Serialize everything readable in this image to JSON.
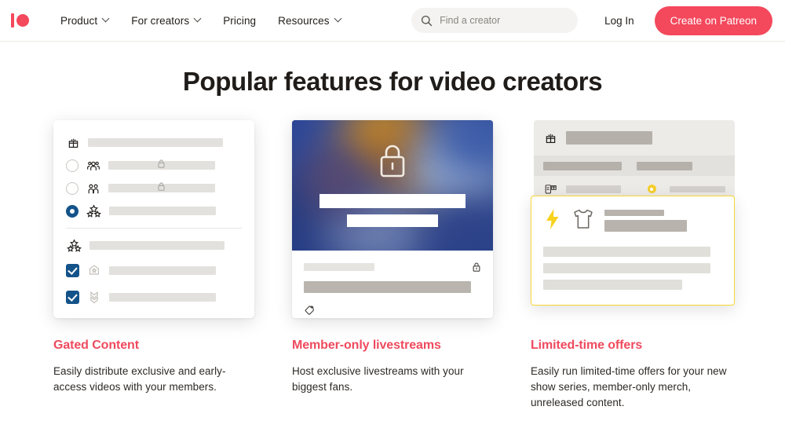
{
  "header": {
    "logo": {
      "name": "patreon-logo",
      "color": "#f4485c"
    },
    "nav": [
      {
        "label": "Product",
        "has_dropdown": true
      },
      {
        "label": "For creators",
        "has_dropdown": true
      },
      {
        "label": "Pricing",
        "has_dropdown": false
      },
      {
        "label": "Resources",
        "has_dropdown": true
      }
    ],
    "search": {
      "placeholder": "Find a creator",
      "value": "",
      "icon": "search-icon"
    },
    "login_label": "Log In",
    "cta_label": "Create on Patreon",
    "cta_color": "#f4485c"
  },
  "page_title": "Popular features for video creators",
  "features": [
    {
      "title": "Gated Content",
      "title_color": "#ef4a5e",
      "description": "Easily distribute exclusive and early-access videos with your members.",
      "mock": {
        "type": "tier-selection-list",
        "rows": [
          {
            "control": "none",
            "icon": "gift-icon",
            "locked": false
          },
          {
            "control": "radio-off",
            "icon": "group-three-icon",
            "locked": true
          },
          {
            "control": "radio-off",
            "icon": "group-two-icon",
            "locked": true
          },
          {
            "control": "radio-on",
            "icon": "stars-icon",
            "locked": false
          },
          {
            "control": "none",
            "icon": "stars-icon",
            "locked": false
          },
          {
            "control": "checkbox-on",
            "icon": "badge-star-icon",
            "locked": false
          },
          {
            "control": "checkbox-on",
            "icon": "bookmark-chevron-icon",
            "locked": false
          }
        ]
      }
    },
    {
      "title": "Member-only livestreams",
      "title_color": "#ef4a5e",
      "description": "Host exclusive livestreams with your biggest fans.",
      "mock": {
        "type": "locked-video-post",
        "thumbnail_icon": "lock-icon",
        "body_icons": [
          "lock-icon",
          "tag-icon"
        ]
      }
    },
    {
      "title": "Limited-time offers",
      "title_color": "#ef4a5e",
      "description": "Easily run limited-time offers for your new show series, member-only merch, unreleased content.",
      "mock": {
        "type": "offer-card-overlay",
        "panel_icons": [
          "gift-icon",
          "phone-gift-icon",
          "gift-icon"
        ],
        "overlay_icons": [
          "lightning-bolt-icon",
          "tshirt-icon"
        ],
        "accent_color": "#f7d635"
      }
    }
  ]
}
